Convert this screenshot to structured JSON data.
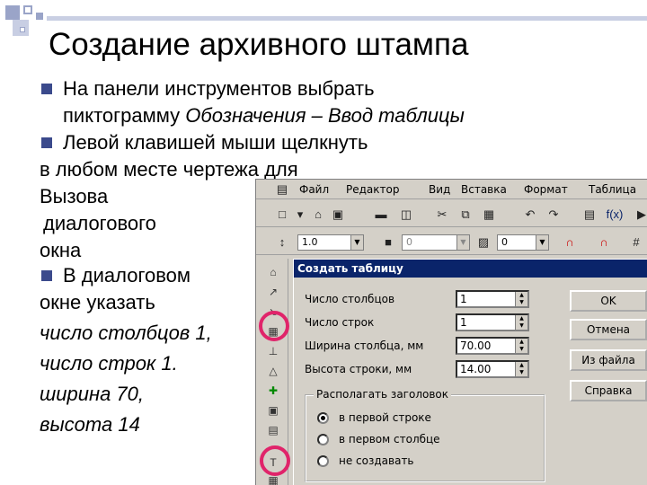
{
  "slide": {
    "title": "Создание архивного штампа",
    "bullets": [
      {
        "line1": "На панели инструментов выбрать",
        "line2_plain": "пиктограмму ",
        "line2_italic": "Обозначения – Ввод таблицы"
      },
      {
        "line1": "Левой клавишей мыши щелкнуть"
      }
    ],
    "lines": [
      "в любом месте чертежа для",
      "Вызова",
      "диалогового",
      "окна"
    ],
    "bullet3": [
      "В диалоговом",
      "окне указать"
    ],
    "italic_lines": [
      "число столбцов 1,",
      "число строк 1.",
      "ширина 70,",
      "высота 14"
    ]
  },
  "app": {
    "menu": [
      "Файл",
      "Редактор",
      "Вид",
      "Вставка",
      "Формат",
      "Таблица"
    ],
    "toolbar2": {
      "linewidth": "1.0",
      "field2": "0",
      "field3": "0"
    },
    "icons_tb1": [
      "new-icon",
      "open-icon",
      "save-icon",
      "cut-icon",
      "copy-icon",
      "paste-icon",
      "undo-icon",
      "redo-icon",
      "fx-icon"
    ],
    "fx_label": "f(x)"
  },
  "dialog": {
    "title": "Создать таблицу",
    "fields": [
      {
        "label": "Число столбцов",
        "value": "1"
      },
      {
        "label": "Число строк",
        "value": "1"
      },
      {
        "label": "Ширина столбца, мм",
        "value": "70.00"
      },
      {
        "label": "Высота строки, мм",
        "value": "14.00"
      }
    ],
    "buttons": [
      "OK",
      "Отмена",
      "Из файла",
      "Справка"
    ],
    "group_title": "Располагать заголовок",
    "radios": [
      {
        "label": "в первой строке",
        "checked": true
      },
      {
        "label": "в первом столбце",
        "checked": false
      },
      {
        "label": "не создавать",
        "checked": false
      }
    ]
  },
  "colors": {
    "bullet": "#3b4a8c",
    "highlight_ring": "#e0246a",
    "title_bar": "#0a246a",
    "panel": "#d4d0c8"
  }
}
